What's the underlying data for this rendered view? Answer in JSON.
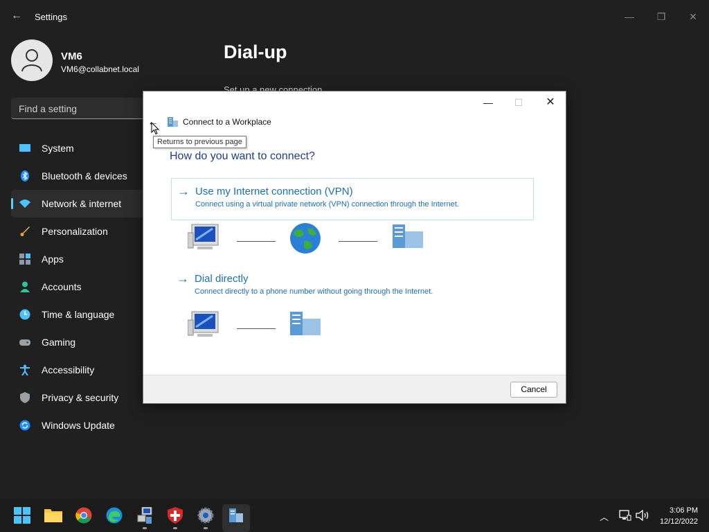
{
  "settings": {
    "app_title": "Settings",
    "user": {
      "name": "VM6",
      "email": "VM6@collabnet.local"
    },
    "search_placeholder": "Find a setting",
    "nav": [
      {
        "label": "System",
        "icon": "system-icon"
      },
      {
        "label": "Bluetooth & devices",
        "icon": "bluetooth-icon"
      },
      {
        "label": "Network & internet",
        "icon": "network-icon",
        "active": true
      },
      {
        "label": "Personalization",
        "icon": "brush-icon"
      },
      {
        "label": "Apps",
        "icon": "apps-icon"
      },
      {
        "label": "Accounts",
        "icon": "accounts-icon"
      },
      {
        "label": "Time & language",
        "icon": "clock-icon"
      },
      {
        "label": "Gaming",
        "icon": "gamepad-icon"
      },
      {
        "label": "Accessibility",
        "icon": "accessibility-icon"
      },
      {
        "label": "Privacy & security",
        "icon": "shield-icon"
      },
      {
        "label": "Windows Update",
        "icon": "update-icon"
      }
    ],
    "page_title": "Dial-up",
    "page_subtitle": "Set up a new connection"
  },
  "dialog": {
    "title": "Connect to a Workplace",
    "tooltip": "Returns to previous page",
    "question": "How do you want to connect?",
    "options": [
      {
        "title": "Use my Internet connection (VPN)",
        "desc": "Connect using a virtual private network (VPN) connection through the Internet."
      },
      {
        "title": "Dial directly",
        "desc": "Connect directly to a phone number without going through the Internet."
      }
    ],
    "cancel_label": "Cancel"
  },
  "taskbar": {
    "apps": [
      "start-icon",
      "file-explorer-icon",
      "chrome-icon",
      "edge-icon",
      "network-tool-icon",
      "shield-app-icon",
      "settings-gear-icon",
      "connect-workplace-icon"
    ],
    "time": "3:06 PM",
    "date": "12/12/2022"
  },
  "colors": {
    "accent": "#60cdff",
    "link_blue": "#1a6fb8",
    "heading_blue": "#1e3c8a"
  }
}
